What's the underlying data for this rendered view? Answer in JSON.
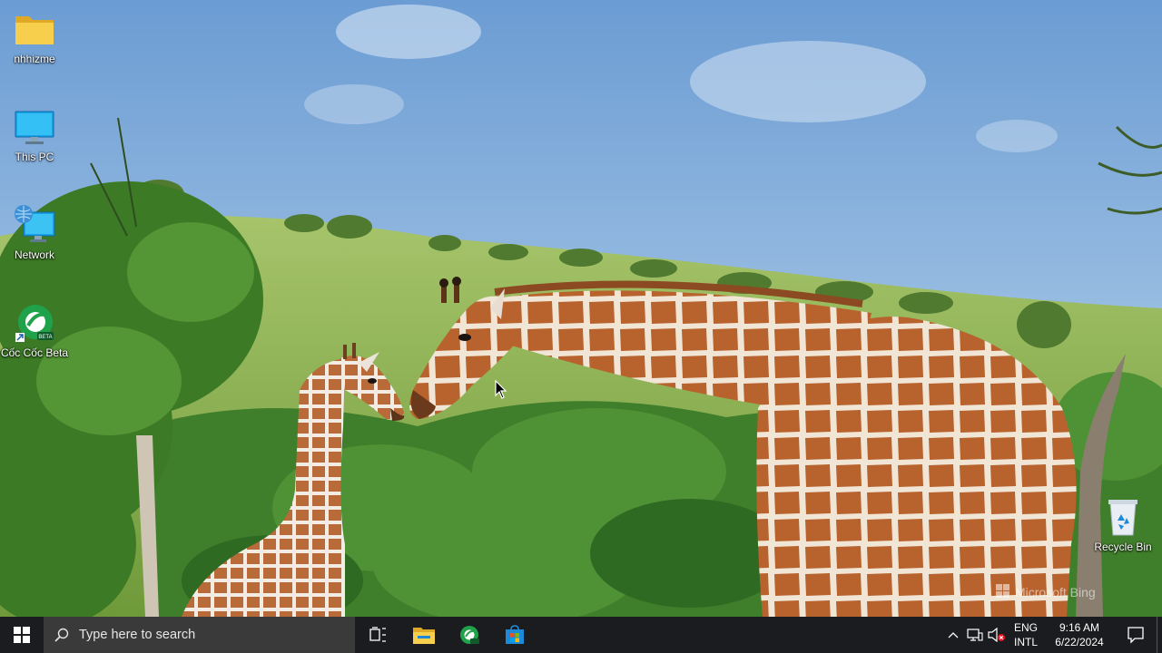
{
  "desktop": {
    "icons": [
      {
        "label": "nhhizme",
        "icon": "folder-icon"
      },
      {
        "label": "This PC",
        "icon": "monitor-icon"
      },
      {
        "label": "Network",
        "icon": "network-icon"
      },
      {
        "label": "Cốc Cốc Beta",
        "icon": "coccoc-beta-icon"
      },
      {
        "label": "Recycle Bin",
        "icon": "recycle-bin-icon"
      }
    ],
    "watermark": "Microsoft Bing"
  },
  "taskbar": {
    "search_placeholder": "Type here to search",
    "pinned_apps": [
      "task-view-icon",
      "file-explorer-icon",
      "coccoc-icon",
      "microsoft-store-icon"
    ],
    "tray": {
      "language_line1": "ENG",
      "language_line2": "INTL",
      "time": "9:16 AM",
      "date": "6/22/2024"
    }
  },
  "colors": {
    "taskbar_bg": "#1b1c1f",
    "search_bg": "#3a3a3a",
    "folder": "#f4c542",
    "accent_blue": "#0078d7"
  }
}
